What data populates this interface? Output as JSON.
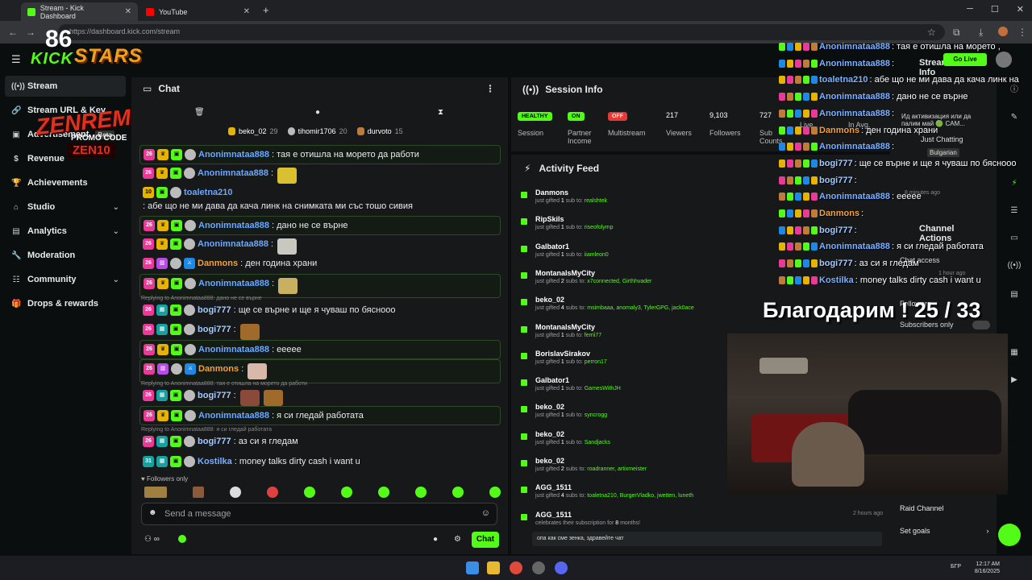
{
  "browser": {
    "tabs": [
      {
        "label": "Stream - Kick Dashboard",
        "active": true
      },
      {
        "label": "YouTube",
        "active": false
      }
    ],
    "url": "https://dashboard.kick.com/stream"
  },
  "overlay": {
    "logo": "KICK",
    "stars": "STARS",
    "promo_title": "ZENREMASTA",
    "promo_label": "PROMO CODE",
    "promo_code": "ZEN10",
    "thanks": "Благодарим ! 25 / 33"
  },
  "sidebar": {
    "items": [
      {
        "label": "Stream",
        "icon": "broadcast-icon",
        "active": true
      },
      {
        "label": "Stream URL & Key",
        "icon": "link-icon"
      },
      {
        "label": "Advertisement",
        "icon": "ad-icon",
        "badge": "Beta"
      },
      {
        "label": "Revenue",
        "icon": "dollar-icon"
      },
      {
        "label": "Achievements",
        "icon": "trophy-icon"
      },
      {
        "label": "Studio",
        "icon": "studio-icon",
        "expand": true
      },
      {
        "label": "Analytics",
        "icon": "analytics-icon",
        "expand": true
      },
      {
        "label": "Moderation",
        "icon": "wrench-icon"
      },
      {
        "label": "Community",
        "icon": "community-icon",
        "expand": true
      },
      {
        "label": "Drops & rewards",
        "icon": "gift-icon"
      }
    ]
  },
  "chat": {
    "title": "Chat",
    "pinned": [
      {
        "name": "beko_02",
        "count": "29"
      },
      {
        "name": "tihomir1706",
        "count": "20"
      },
      {
        "name": "durvoto",
        "count": "15"
      }
    ],
    "messages": [
      {
        "user": "Anonimnataa888",
        "text": ": тая е отишла на морето да работи",
        "color": "#6aa8ff"
      },
      {
        "user": "Anonimnataa888",
        "text": ":",
        "color": "#6aa8ff"
      },
      {
        "user": "toaletna210",
        "text": ": абе що не ми дава да кача линк на снимката ми със тошо сивия",
        "color": "#6aa8ff"
      },
      {
        "user": "Anonimnataa888",
        "text": ": дано не се върне",
        "color": "#6aa8ff"
      },
      {
        "user": "Anonimnataa888",
        "text": ":",
        "color": "#6aa8ff"
      },
      {
        "user": "Danmons",
        "text": ": ден година храни",
        "color": "#f2a03d"
      },
      {
        "user": "Anonimnataa888",
        "text": ":",
        "color": "#6aa8ff"
      },
      {
        "user": "bogi777",
        "text": ": ще се върне и ще я чуваш по бясноoo",
        "color": "#a5c9ff",
        "reply": "Replying to Anonimnataa888: дано не се върне"
      },
      {
        "user": "bogi777",
        "text": ":",
        "color": "#a5c9ff"
      },
      {
        "user": "Anonimnataa888",
        "text": ": eeeee",
        "color": "#6aa8ff"
      },
      {
        "user": "Danmons",
        "text": ":",
        "color": "#f2a03d"
      },
      {
        "user": "bogi777",
        "text": ":",
        "color": "#a5c9ff",
        "reply": "Replying to Anonimnataa888: тая е отишла на морето да работи"
      },
      {
        "user": "Anonimnataa888",
        "text": ": я си гледай работата",
        "color": "#6aa8ff"
      },
      {
        "user": "bogi777",
        "text": ": аз си я гледам",
        "color": "#a5c9ff",
        "reply": "Replying to Anonimnataa888: я си гледай работата"
      },
      {
        "user": "Kostilka",
        "text": ": money talks dirty cash i want u",
        "color": "#7ab0ff"
      }
    ],
    "followers_only": "Followers only",
    "placeholder": "Send a message",
    "send_label": "Chat"
  },
  "session": {
    "title": "Session Info",
    "stats": [
      {
        "value": "HEALTHY",
        "label": "Session",
        "pill": "#53fc18"
      },
      {
        "value": "ON",
        "label": "Partner Income",
        "pill": "#53fc18"
      },
      {
        "value": "OFF",
        "label": "Multistream",
        "pill": "#e53935"
      },
      {
        "value": "217",
        "label": "Viewers"
      },
      {
        "value": "9,103",
        "label": "Followers"
      },
      {
        "value": "727",
        "label": "Sub Counts"
      },
      {
        "value": "",
        "label": "Live"
      },
      {
        "value": "",
        "label": "In Avg."
      }
    ]
  },
  "activity": {
    "title": "Activity Feed",
    "items": [
      {
        "name": "Danmons",
        "pre": "just gifted ",
        "n": "1",
        "mid": " sub to: ",
        "to": "realshtek",
        "time": ""
      },
      {
        "name": "RipSkils",
        "pre": "just gifted ",
        "n": "1",
        "mid": " sub to: ",
        "to": "riseofolymp",
        "time": ""
      },
      {
        "name": "Galbator1",
        "pre": "just gifted ",
        "n": "1",
        "mid": " sub to: ",
        "to": "iiamleon0",
        "time": ""
      },
      {
        "name": "MontanalsMyCity",
        "pre": "just gifted ",
        "n": "2",
        "mid": " subs to: ",
        "to": "x7connected, Girthhvader",
        "time": ""
      },
      {
        "name": "beko_02",
        "pre": "just gifted ",
        "n": "4",
        "mid": " subs to: ",
        "to": "msimbaaa, anomaly3, TylerGPG, jack0ace",
        "time": ""
      },
      {
        "name": "MontanalsMyCity",
        "pre": "just gifted ",
        "n": "1",
        "mid": " sub to: ",
        "to": "ferrii77",
        "time": ""
      },
      {
        "name": "BorislavSirakov",
        "pre": "just gifted ",
        "n": "1",
        "mid": " sub to: ",
        "to": "perron17",
        "time": ""
      },
      {
        "name": "Galbator1",
        "pre": "just gifted ",
        "n": "1",
        "mid": " sub to: ",
        "to": "GamesWithJH",
        "time": ""
      },
      {
        "name": "beko_02",
        "pre": "just gifted ",
        "n": "1",
        "mid": " sub to: ",
        "to": "syncrogg",
        "time": ""
      },
      {
        "name": "beko_02",
        "pre": "just gifted ",
        "n": "1",
        "mid": " sub to: ",
        "to": "Sandjacks",
        "time": ""
      },
      {
        "name": "beko_02",
        "pre": "just gifted ",
        "n": "2",
        "mid": " subs to: ",
        "to": "roadranner, artixmeister",
        "time": ""
      },
      {
        "name": "AGG_1511",
        "pre": "just gifted ",
        "n": "4",
        "mid": " subs to: ",
        "to": "toaletna210, BurgerVladko, jwetten, luneth",
        "time": ""
      },
      {
        "name": "AGG_1511",
        "pre": "celebrates their subscription for ",
        "n": "8",
        "mid": " months!",
        "to": "",
        "time": "2 hours ago"
      }
    ],
    "last_message": "опа как сме зенка, здравейте чат"
  },
  "overlay_chat": [
    {
      "user": "Anonimnataa888",
      "text": ": тая е отишла на морето ,"
    },
    {
      "user": "Anonimnataa888",
      "text": ":"
    },
    {
      "user": "toaletna210",
      "text": ": абе що не ми дава да кача линк на"
    },
    {
      "user": "Anonimnataa888",
      "text": ": дано не се върне"
    },
    {
      "user": "Anonimnataa888",
      "text": ":"
    },
    {
      "user": "Danmons",
      "text": ": ден година храни"
    },
    {
      "user": "Anonimnataa888",
      "text": ":"
    },
    {
      "user": "bogi777",
      "text": ": ще се върне и ще я чуваш по бясноoo"
    },
    {
      "user": "bogi777",
      "text": ":"
    },
    {
      "user": "Anonimnataa888",
      "text": ": eeeee"
    },
    {
      "user": "Danmons",
      "text": ":"
    },
    {
      "user": "bogi777",
      "text": ":"
    },
    {
      "user": "Anonimnataa888",
      "text": ": я си гледай работата"
    },
    {
      "user": "bogi777",
      "text": ": аз си я гледам"
    },
    {
      "user": "Kostilka",
      "text": ": money talks dirty cash i want u"
    }
  ],
  "right_panel": {
    "stream_info": "Stream Info",
    "category_line": "Ид активизация или да палим май 🟢 CAM...",
    "category": "Just Chatting",
    "language": "Bulgarian",
    "minutes_ago": "8 minutes ago",
    "channel_actions": "Channel Actions",
    "chat_access": "Chat access",
    "followers": "Followers",
    "subscribers_only": "Subscribers only",
    "hour_ago": "1 hour ago",
    "raid": "Raid Channel",
    "goals": "Set goals",
    "go_live": "Go Live"
  },
  "taskbar": {
    "time": "12:17 AM",
    "date": "8/16/2025",
    "lang": "БГР"
  }
}
